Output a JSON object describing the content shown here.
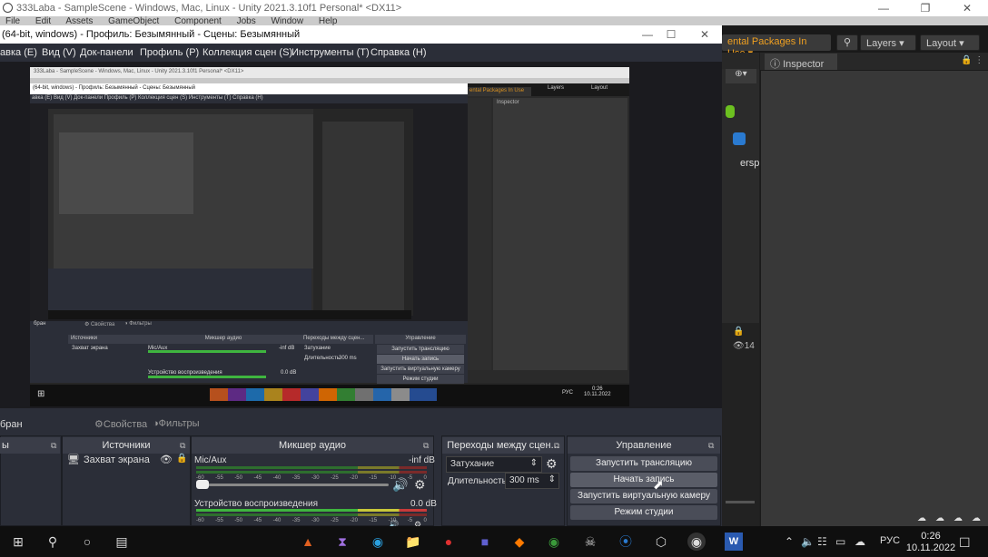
{
  "unity": {
    "title": "333Laba - SampleScene - Windows, Mac, Linux - Unity 2021.3.10f1 Personal* <DX11>",
    "menu": [
      "File",
      "Edit",
      "Assets",
      "GameObject",
      "Component",
      "Jobs",
      "Window",
      "Help"
    ],
    "packages_label": "ental Packages In Use",
    "layers_label": "Layers",
    "layout_label": "Layout",
    "inspector_label": "Inspector",
    "scene_fragment": "ersp",
    "count_badge": "14"
  },
  "obs": {
    "title": "(64-bit, windows) - Профиль: Безымянный - Сцены: Безымянный",
    "menu": [
      "авка (E)",
      "Вид (V)",
      "Док-панели",
      "Профиль (P)",
      "Коллекция сцен (S)",
      "Инструменты (T)",
      "Справка (H)"
    ],
    "scene_label": "бран",
    "properties_label": "Свойства",
    "filters_label": "Фильтры",
    "docks": {
      "scenes_head": "ы",
      "sources_head": "Источники",
      "mixer_head": "Микшер аудио",
      "transitions_head": "Переходы между сцен...",
      "controls_head": "Управление"
    },
    "sources": [
      "Захват экрана"
    ],
    "mixer": [
      {
        "name": "Mic/Aux",
        "level": "-inf dB"
      },
      {
        "name": "Устройство воспроизведения",
        "level": "0.0 dB"
      }
    ],
    "meter_scale": [
      "-60",
      "-55",
      "-50",
      "-45",
      "-40",
      "-35",
      "-30",
      "-25",
      "-20",
      "-15",
      "-10",
      "-5",
      "0"
    ],
    "transition": {
      "type": "Затухание",
      "duration_label": "Длительность",
      "duration_value": "300 ms"
    },
    "controls": [
      "Запустить трансляцию",
      "Начать запись",
      "Запустить виртуальную камеру",
      "Режим студии"
    ]
  },
  "nested": {
    "unity_title": "333Laba - SampleScene - Windows, Mac, Linux - Unity 2021.3.10f1 Personal* <DX11>",
    "obs_title": "(64-bit, windows) - Профиль: Безымянный - Сцены: Безымянный",
    "menu": "авка (E)   Вид (V)   Док-панели   Профиль (P)   Коллекция сцен (S)   Инструменты (T)   Справка (H)",
    "packages_label": "ental Packages In Use",
    "layers_label": "Layers",
    "layout_label": "Layout",
    "inspector_label": "Inspector",
    "scene_label": "бран",
    "properties_label": "Свойства",
    "filters_label": "Фильтры",
    "sources_head": "Источники",
    "mixer_head": "Микшер аудио",
    "transitions_head": "Переходы между сцен...",
    "controls_head": "Управление",
    "source": "Захват экрана",
    "mic": "Mic/Aux",
    "mic_level": "-inf dB",
    "device": "Устройство воспроизведения",
    "device_level": "0.0 dB",
    "transition": "Затухание",
    "duration_label": "Длительность",
    "duration_value": "300 ms",
    "controls": [
      "Запустить трансляцию",
      "Начать запись",
      "Запустить виртуальную камеру",
      "Режим студии"
    ],
    "time": "0:26",
    "date": "10.11.2022",
    "lang": "РУС"
  },
  "taskbar": {
    "time": "0:26",
    "date": "10.11.2022",
    "lang": "РУС"
  },
  "colors": {
    "obs_bg": "#2b2e38",
    "unity_bg": "#383838",
    "accent_orange": "#f0a020",
    "meter_green": "#3fb53f",
    "meter_yellow": "#c8c83a",
    "meter_red": "#c83a3a"
  }
}
